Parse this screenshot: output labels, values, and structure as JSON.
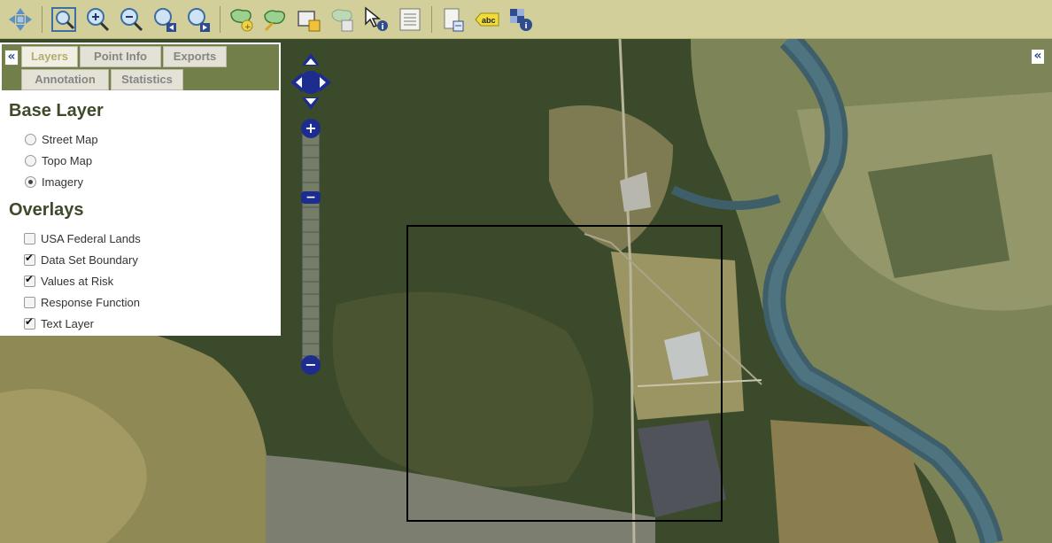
{
  "toolbar": {
    "tools": [
      "pan-icon",
      "zoom-extent-icon",
      "zoom-in-icon",
      "zoom-out-icon",
      "zoom-previous-icon",
      "zoom-next-icon",
      "add-area-icon",
      "draw-area-icon",
      "edit-shape-icon",
      "area-table-icon",
      "identify-icon",
      "report-icon",
      "print-icon",
      "label-icon",
      "legend-info-icon"
    ]
  },
  "panel": {
    "tabs": {
      "layers": "Layers",
      "point_info": "Point Info",
      "exports": "Exports",
      "annotation": "Annotation",
      "statistics": "Statistics"
    },
    "collapse_label": "«",
    "base_layer": {
      "title": "Base Layer",
      "options": [
        "Street Map",
        "Topo Map",
        "Imagery"
      ],
      "selected": "Imagery"
    },
    "overlays": {
      "title": "Overlays",
      "items": [
        {
          "label": "USA Federal Lands",
          "checked": false
        },
        {
          "label": "Data Set Boundary",
          "checked": true
        },
        {
          "label": "Values at Risk",
          "checked": true
        },
        {
          "label": "Response Function",
          "checked": false
        },
        {
          "label": "Text Layer",
          "checked": true
        }
      ]
    }
  },
  "map": {
    "right_collapse_label": "«",
    "zoom_in_label": "+",
    "zoom_out_label": "−",
    "zoom_slider_label": "−"
  },
  "colors": {
    "toolbar_bg": "#d2cf9a",
    "panel_header": "#737f4a",
    "control_blue": "#1d2c8f",
    "boundary": "#000000"
  }
}
